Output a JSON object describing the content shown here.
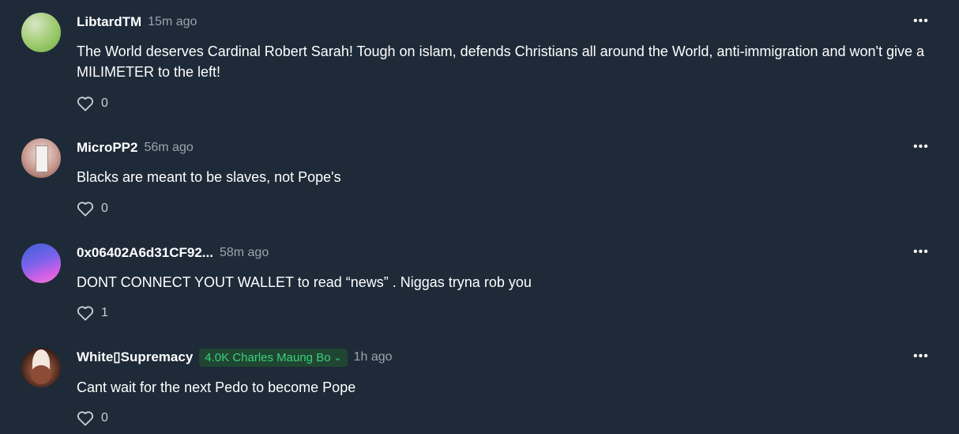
{
  "comments": [
    {
      "username": "LibtardTM",
      "time": "15m ago",
      "badge": "",
      "text": "The World deserves Cardinal Robert Sarah! Tough on islam, defends Christians all around the World, anti-immigration and won't give a MILIMETER to the left!",
      "likes": "0"
    },
    {
      "username": "MicroPP2",
      "time": "56m ago",
      "badge": "",
      "text": "Blacks are meant to be slaves, not Pope's",
      "likes": "0"
    },
    {
      "username": "0x06402A6d31CF92...",
      "time": "58m ago",
      "badge": "",
      "text": "DONT CONNECT YOUT WALLET to read “news” . Niggas tryna rob you",
      "likes": "1"
    },
    {
      "username": "White▯Supremacy",
      "time": "1h ago",
      "badge": "4.0K Charles Maung Bo",
      "text": "Cant wait for the next Pedo to become Pope",
      "likes": "0"
    }
  ],
  "icons": {
    "like": "heart-outline-icon",
    "more": "more-horizontal-icon",
    "badge_chevron": "chevron-down-icon"
  },
  "colors": {
    "background": "#1e2a38",
    "badge_bg": "#1f4632",
    "badge_text": "#3ccf7a",
    "muted_text": "#9aa4b1"
  }
}
